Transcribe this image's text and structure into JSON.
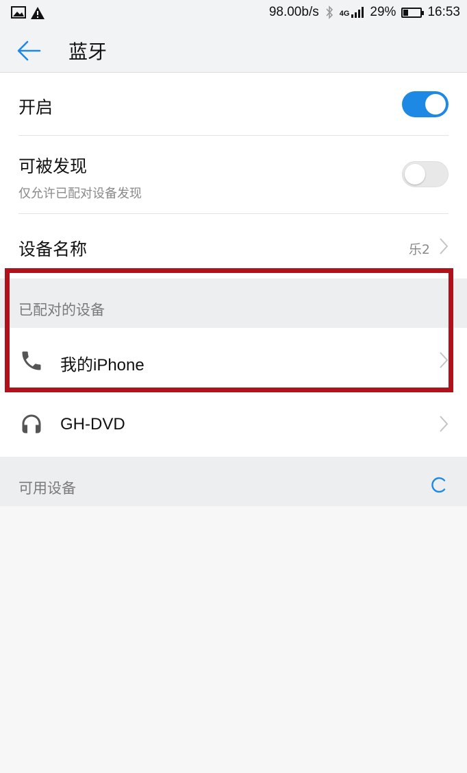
{
  "status_bar": {
    "speed": "98.00b/s",
    "network_type": "4G",
    "battery_percent": "29%",
    "battery_level": 0.29,
    "time": "16:53",
    "icons": [
      "image-icon",
      "warning-icon",
      "bluetooth-icon",
      "signal-icon",
      "battery-icon"
    ]
  },
  "header": {
    "title": "蓝牙",
    "back_icon": "back-arrow-icon"
  },
  "settings": {
    "enable": {
      "label": "开启",
      "state": true
    },
    "discoverable": {
      "label": "可被发现",
      "sublabel": "仅允许已配对设备发现",
      "state": false
    },
    "device_name": {
      "label": "设备名称",
      "value": "乐2"
    }
  },
  "paired_section": {
    "title": "已配对的设备",
    "devices": [
      {
        "name": "我的iPhone",
        "icon": "phone-icon"
      },
      {
        "name": "GH-DVD",
        "icon": "headphones-icon"
      }
    ]
  },
  "available_section": {
    "title": "可用设备",
    "icon": "loading-spinner-icon"
  },
  "colors": {
    "accent": "#1e88e5",
    "highlight": "#b0121b"
  }
}
